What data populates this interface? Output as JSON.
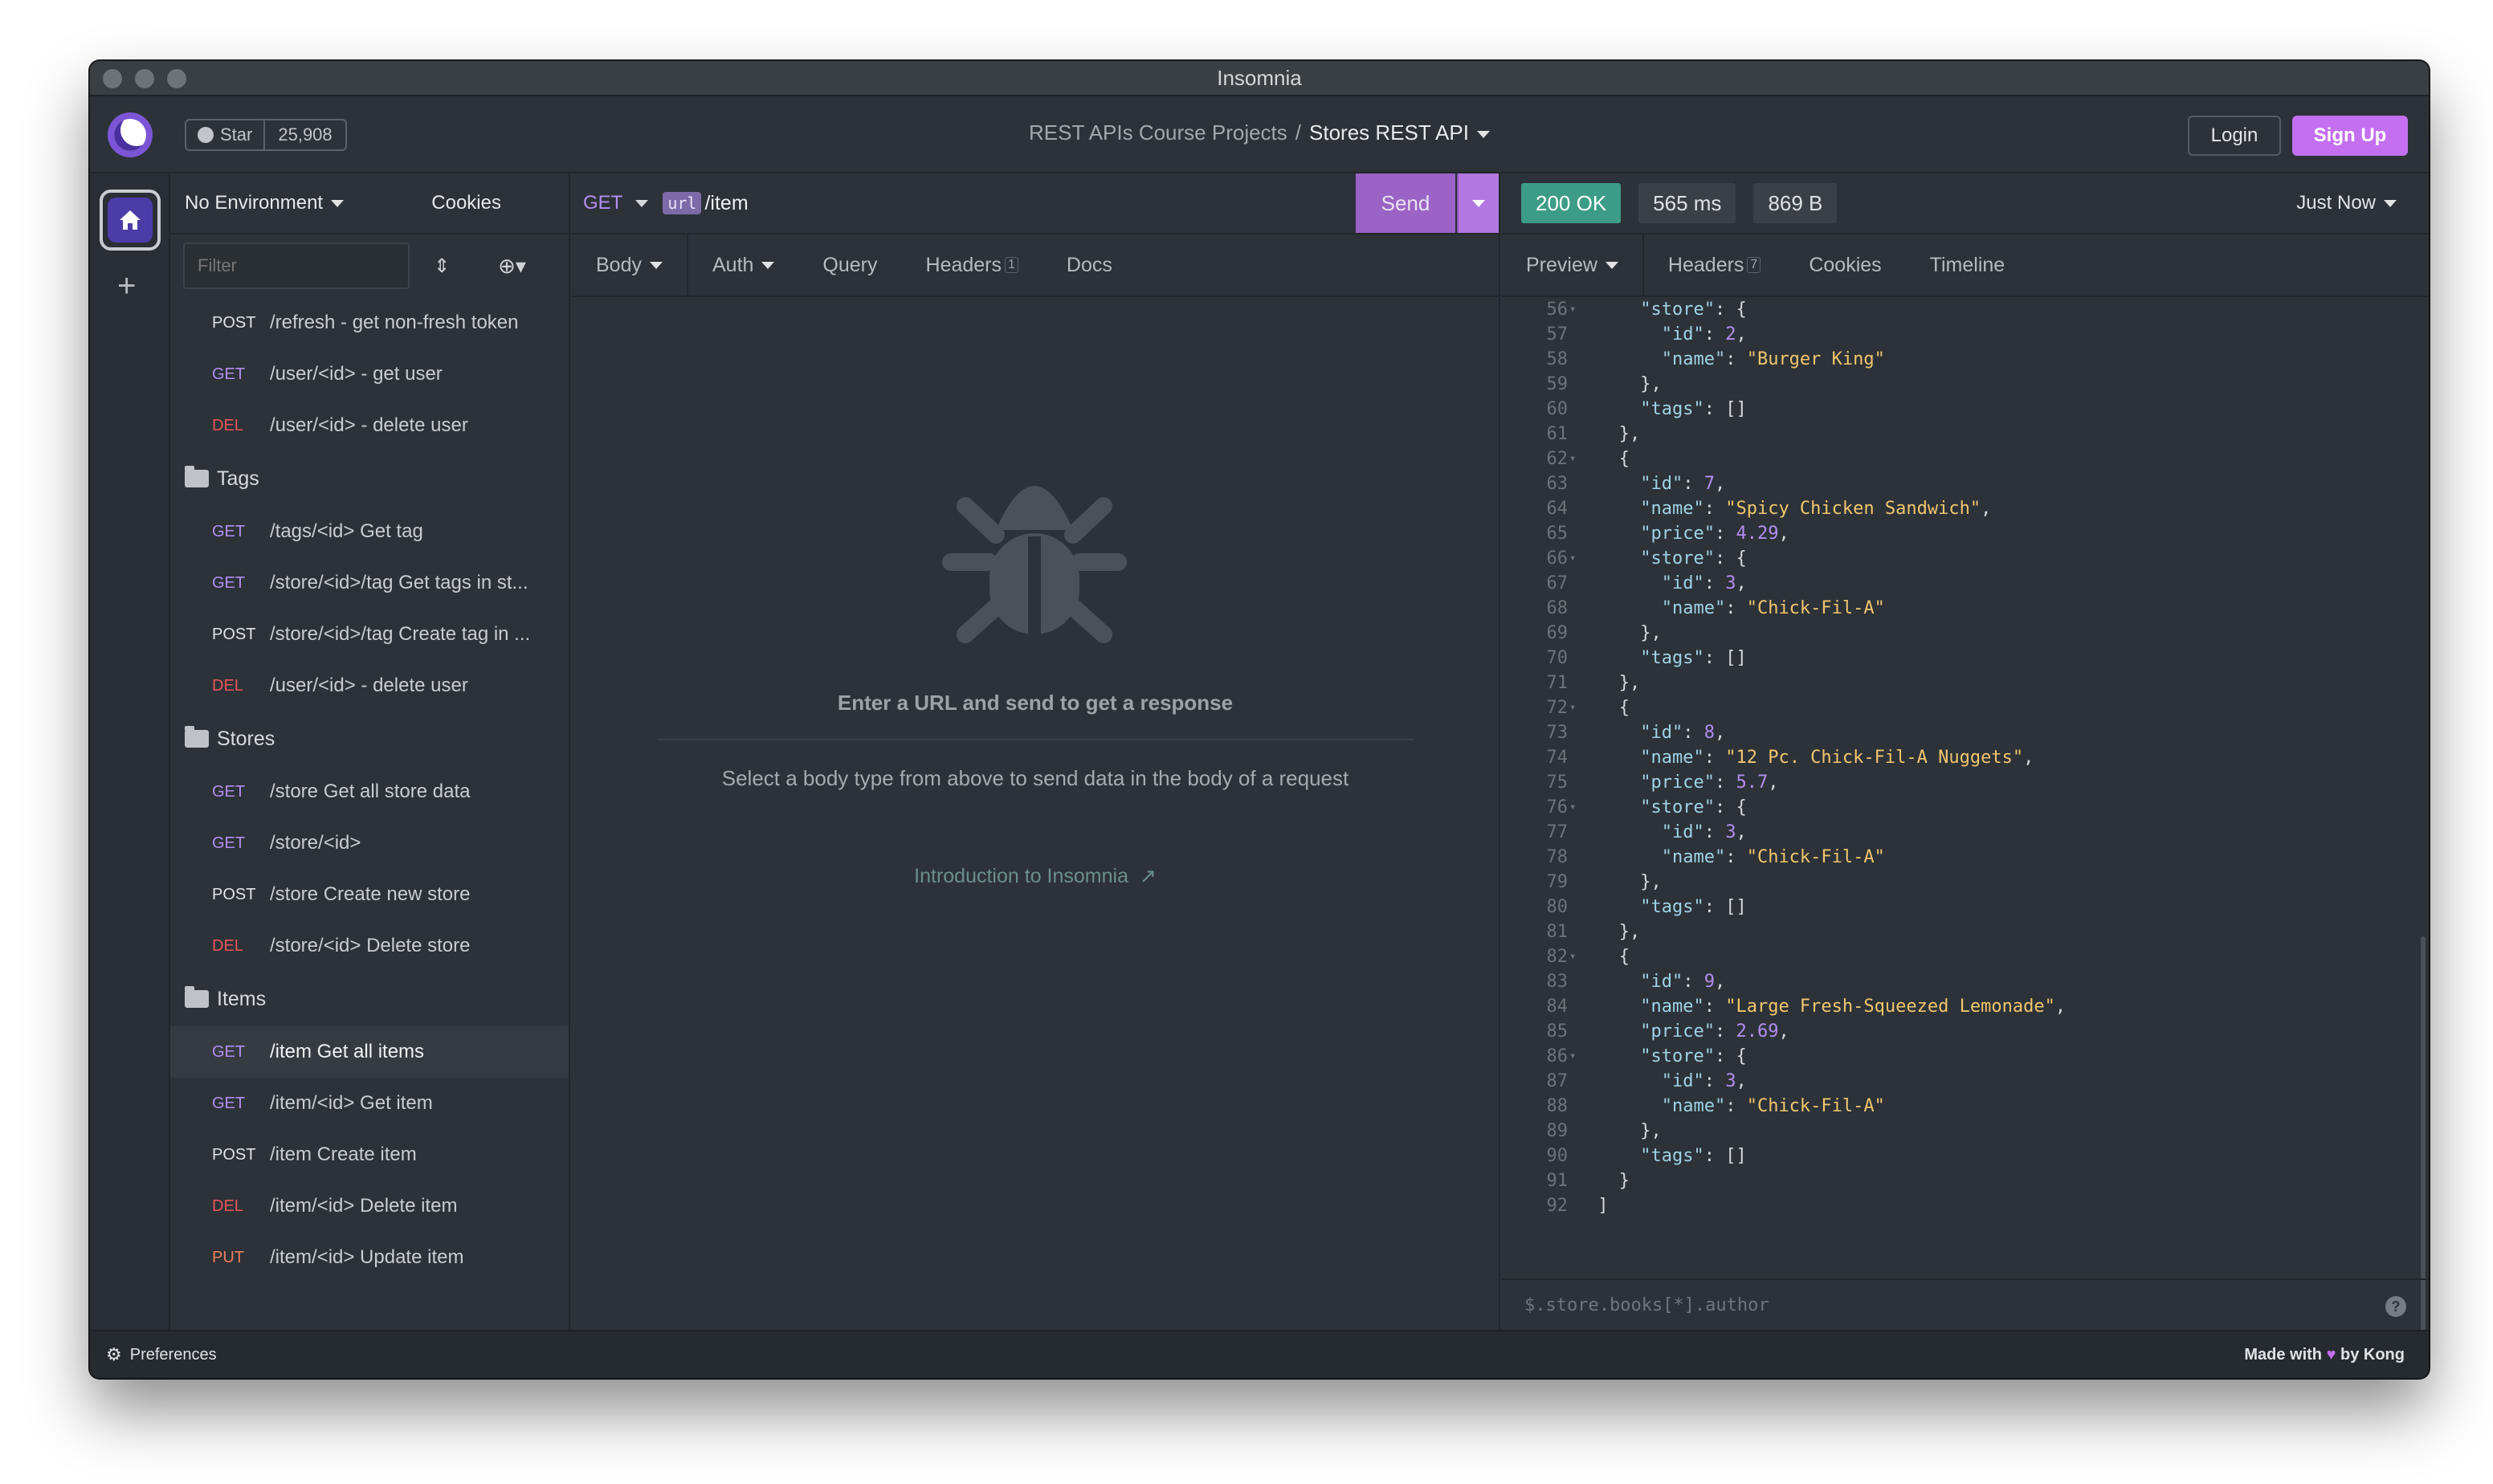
{
  "window": {
    "title": "Insomnia"
  },
  "header": {
    "github": {
      "star_label": "Star",
      "star_count": "25,908"
    },
    "breadcrumb": {
      "project": "REST APIs Course Projects",
      "separator": "/",
      "workspace": "Stores REST API"
    },
    "login_label": "Login",
    "signup_label": "Sign Up"
  },
  "sidebar": {
    "environment": "No Environment",
    "cookies_label": "Cookies",
    "filter_placeholder": "Filter",
    "top_requests": [
      {
        "method": "POST",
        "label": "/refresh - get non-fresh token"
      },
      {
        "method": "GET",
        "label": "/user/<id> - get user"
      },
      {
        "method": "DEL",
        "label": "/user/<id> - delete user"
      }
    ],
    "folders": [
      {
        "name": "Tags",
        "requests": [
          {
            "method": "GET",
            "label": "/tags/<id> Get tag"
          },
          {
            "method": "GET",
            "label": "/store/<id>/tag Get tags in st..."
          },
          {
            "method": "POST",
            "label": "/store/<id>/tag Create tag in ..."
          },
          {
            "method": "DEL",
            "label": "/user/<id> - delete user"
          }
        ]
      },
      {
        "name": "Stores",
        "requests": [
          {
            "method": "GET",
            "label": "/store Get all store data"
          },
          {
            "method": "GET",
            "label": "/store/<id>"
          },
          {
            "method": "POST",
            "label": "/store Create new store"
          },
          {
            "method": "DEL",
            "label": "/store/<id> Delete store"
          }
        ]
      },
      {
        "name": "Items",
        "requests": [
          {
            "method": "GET",
            "label": "/item Get all items",
            "active": true
          },
          {
            "method": "GET",
            "label": "/item/<id> Get item"
          },
          {
            "method": "POST",
            "label": "/item Create item"
          },
          {
            "method": "DEL",
            "label": "/item/<id> Delete item"
          },
          {
            "method": "PUT",
            "label": "/item/<id> Update item"
          }
        ]
      }
    ]
  },
  "request": {
    "method": "GET",
    "url_variable": "url",
    "url_path": "/item",
    "send_label": "Send",
    "tabs": [
      {
        "label": "Body"
      },
      {
        "label": "Auth"
      },
      {
        "label": "Query"
      },
      {
        "label": "Headers",
        "count": "1"
      },
      {
        "label": "Docs"
      }
    ],
    "empty_title": "Enter a URL and send to get a response",
    "empty_subtitle": "Select a body type from above to send data in the body of a request",
    "intro_link": "Introduction to Insomnia"
  },
  "response": {
    "status": "200 OK",
    "time": "565 ms",
    "size": "869 B",
    "timestamp": "Just Now",
    "tabs": [
      {
        "label": "Preview"
      },
      {
        "label": "Headers",
        "count": "7"
      },
      {
        "label": "Cookies"
      },
      {
        "label": "Timeline"
      }
    ],
    "code_lines": [
      {
        "n": "56",
        "fold": true,
        "indent": 4,
        "tokens": [
          [
            "k",
            "\"store\""
          ],
          [
            "p",
            ": {"
          ]
        ]
      },
      {
        "n": "57",
        "indent": 6,
        "tokens": [
          [
            "k",
            "\"id\""
          ],
          [
            "p",
            ": "
          ],
          [
            "n",
            "2"
          ],
          [
            "p",
            ","
          ]
        ]
      },
      {
        "n": "58",
        "indent": 6,
        "tokens": [
          [
            "k",
            "\"name\""
          ],
          [
            "p",
            ": "
          ],
          [
            "s",
            "\"Burger King\""
          ]
        ]
      },
      {
        "n": "59",
        "indent": 4,
        "tokens": [
          [
            "p",
            "},"
          ]
        ]
      },
      {
        "n": "60",
        "indent": 4,
        "tokens": [
          [
            "k",
            "\"tags\""
          ],
          [
            "p",
            ": []"
          ]
        ]
      },
      {
        "n": "61",
        "indent": 2,
        "tokens": [
          [
            "p",
            "},"
          ]
        ]
      },
      {
        "n": "62",
        "fold": true,
        "indent": 2,
        "tokens": [
          [
            "p",
            "{"
          ]
        ]
      },
      {
        "n": "63",
        "indent": 4,
        "tokens": [
          [
            "k",
            "\"id\""
          ],
          [
            "p",
            ": "
          ],
          [
            "n",
            "7"
          ],
          [
            "p",
            ","
          ]
        ]
      },
      {
        "n": "64",
        "indent": 4,
        "tokens": [
          [
            "k",
            "\"name\""
          ],
          [
            "p",
            ": "
          ],
          [
            "s",
            "\"Spicy Chicken Sandwich\""
          ],
          [
            "p",
            ","
          ]
        ]
      },
      {
        "n": "65",
        "indent": 4,
        "tokens": [
          [
            "k",
            "\"price\""
          ],
          [
            "p",
            ": "
          ],
          [
            "n",
            "4.29"
          ],
          [
            "p",
            ","
          ]
        ]
      },
      {
        "n": "66",
        "fold": true,
        "indent": 4,
        "tokens": [
          [
            "k",
            "\"store\""
          ],
          [
            "p",
            ": {"
          ]
        ]
      },
      {
        "n": "67",
        "indent": 6,
        "tokens": [
          [
            "k",
            "\"id\""
          ],
          [
            "p",
            ": "
          ],
          [
            "n",
            "3"
          ],
          [
            "p",
            ","
          ]
        ]
      },
      {
        "n": "68",
        "indent": 6,
        "tokens": [
          [
            "k",
            "\"name\""
          ],
          [
            "p",
            ": "
          ],
          [
            "s",
            "\"Chick-Fil-A\""
          ]
        ]
      },
      {
        "n": "69",
        "indent": 4,
        "tokens": [
          [
            "p",
            "},"
          ]
        ]
      },
      {
        "n": "70",
        "indent": 4,
        "tokens": [
          [
            "k",
            "\"tags\""
          ],
          [
            "p",
            ": []"
          ]
        ]
      },
      {
        "n": "71",
        "indent": 2,
        "tokens": [
          [
            "p",
            "},"
          ]
        ]
      },
      {
        "n": "72",
        "fold": true,
        "indent": 2,
        "tokens": [
          [
            "p",
            "{"
          ]
        ]
      },
      {
        "n": "73",
        "indent": 4,
        "tokens": [
          [
            "k",
            "\"id\""
          ],
          [
            "p",
            ": "
          ],
          [
            "n",
            "8"
          ],
          [
            "p",
            ","
          ]
        ]
      },
      {
        "n": "74",
        "indent": 4,
        "tokens": [
          [
            "k",
            "\"name\""
          ],
          [
            "p",
            ": "
          ],
          [
            "s",
            "\"12 Pc. Chick-Fil-A Nuggets\""
          ],
          [
            "p",
            ","
          ]
        ]
      },
      {
        "n": "75",
        "indent": 4,
        "tokens": [
          [
            "k",
            "\"price\""
          ],
          [
            "p",
            ": "
          ],
          [
            "n",
            "5.7"
          ],
          [
            "p",
            ","
          ]
        ]
      },
      {
        "n": "76",
        "fold": true,
        "indent": 4,
        "tokens": [
          [
            "k",
            "\"store\""
          ],
          [
            "p",
            ": {"
          ]
        ]
      },
      {
        "n": "77",
        "indent": 6,
        "tokens": [
          [
            "k",
            "\"id\""
          ],
          [
            "p",
            ": "
          ],
          [
            "n",
            "3"
          ],
          [
            "p",
            ","
          ]
        ]
      },
      {
        "n": "78",
        "indent": 6,
        "tokens": [
          [
            "k",
            "\"name\""
          ],
          [
            "p",
            ": "
          ],
          [
            "s",
            "\"Chick-Fil-A\""
          ]
        ]
      },
      {
        "n": "79",
        "indent": 4,
        "tokens": [
          [
            "p",
            "},"
          ]
        ]
      },
      {
        "n": "80",
        "indent": 4,
        "tokens": [
          [
            "k",
            "\"tags\""
          ],
          [
            "p",
            ": []"
          ]
        ]
      },
      {
        "n": "81",
        "indent": 2,
        "tokens": [
          [
            "p",
            "},"
          ]
        ]
      },
      {
        "n": "82",
        "fold": true,
        "indent": 2,
        "tokens": [
          [
            "p",
            "{"
          ]
        ]
      },
      {
        "n": "83",
        "indent": 4,
        "tokens": [
          [
            "k",
            "\"id\""
          ],
          [
            "p",
            ": "
          ],
          [
            "n",
            "9"
          ],
          [
            "p",
            ","
          ]
        ]
      },
      {
        "n": "84",
        "indent": 4,
        "tokens": [
          [
            "k",
            "\"name\""
          ],
          [
            "p",
            ": "
          ],
          [
            "s",
            "\"Large Fresh-Squeezed Lemonade\""
          ],
          [
            "p",
            ","
          ]
        ]
      },
      {
        "n": "85",
        "indent": 4,
        "tokens": [
          [
            "k",
            "\"price\""
          ],
          [
            "p",
            ": "
          ],
          [
            "n",
            "2.69"
          ],
          [
            "p",
            ","
          ]
        ]
      },
      {
        "n": "86",
        "fold": true,
        "indent": 4,
        "tokens": [
          [
            "k",
            "\"store\""
          ],
          [
            "p",
            ": {"
          ]
        ]
      },
      {
        "n": "87",
        "indent": 6,
        "tokens": [
          [
            "k",
            "\"id\""
          ],
          [
            "p",
            ": "
          ],
          [
            "n",
            "3"
          ],
          [
            "p",
            ","
          ]
        ]
      },
      {
        "n": "88",
        "indent": 6,
        "tokens": [
          [
            "k",
            "\"name\""
          ],
          [
            "p",
            ": "
          ],
          [
            "s",
            "\"Chick-Fil-A\""
          ]
        ]
      },
      {
        "n": "89",
        "indent": 4,
        "tokens": [
          [
            "p",
            "},"
          ]
        ]
      },
      {
        "n": "90",
        "indent": 4,
        "tokens": [
          [
            "k",
            "\"tags\""
          ],
          [
            "p",
            ": []"
          ]
        ]
      },
      {
        "n": "91",
        "indent": 2,
        "tokens": [
          [
            "p",
            "}"
          ]
        ]
      },
      {
        "n": "92",
        "indent": 0,
        "tokens": [
          [
            "p",
            "]"
          ]
        ]
      }
    ],
    "filter_placeholder": "$.store.books[*].author"
  },
  "statusbar": {
    "preferences_label": "Preferences",
    "made_with_prefix": "Made with",
    "made_with_suffix": "by Kong"
  },
  "colors": {
    "accent": "#c36ff0",
    "get": "#b38ef0",
    "del": "#e8555a",
    "put": "#f07d5a",
    "status_ok": "#3d9c88"
  },
  "icons": {
    "home": "home-icon",
    "plus": "plus-icon",
    "bug": "bug-icon",
    "github": "github-icon",
    "external": "external-link-icon",
    "help": "help-icon",
    "gear": "gear-icon"
  }
}
